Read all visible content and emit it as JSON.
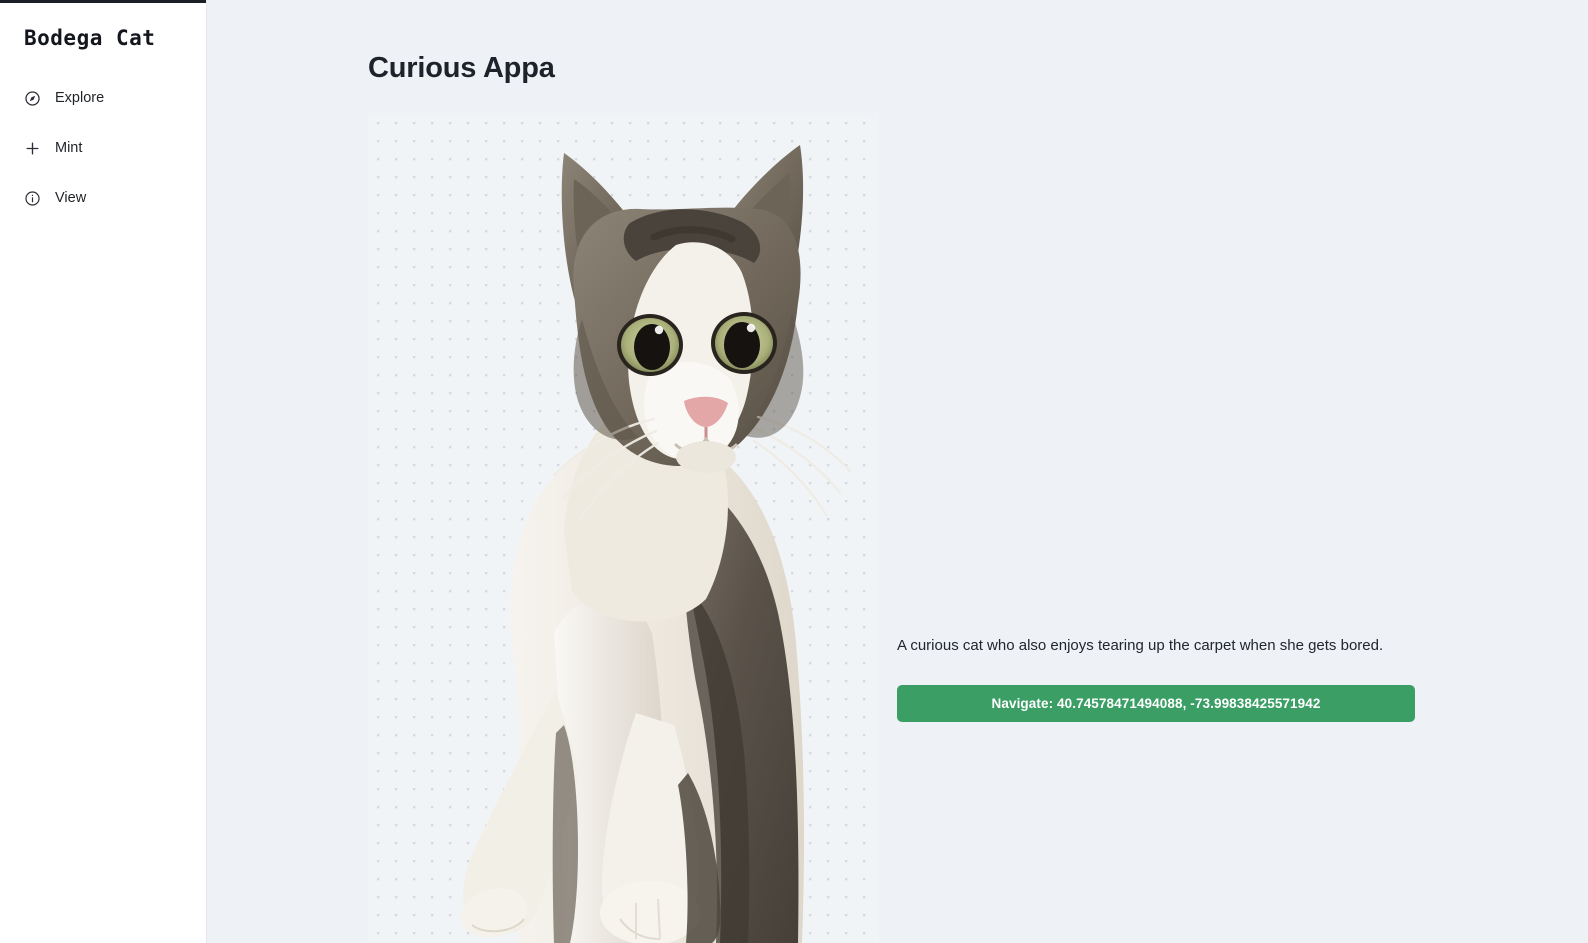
{
  "sidebar": {
    "brand": "Bodega Cat",
    "items": [
      {
        "label": "Explore",
        "icon": "compass-icon"
      },
      {
        "label": "Mint",
        "icon": "plus-icon"
      },
      {
        "label": "View",
        "icon": "info-circle-icon"
      }
    ]
  },
  "main": {
    "title": "Curious Appa",
    "artwork": {
      "alt": "standing-tabby-and-white-cat",
      "background": "dotted-grid"
    },
    "description": "A curious cat who also enjoys tearing up the carpet when she gets bored.",
    "navigate_button": {
      "label": "Navigate: 40.74578471494088, -73.99838425571942",
      "latitude": "40.74578471494088",
      "longitude": "-73.99838425571942"
    }
  },
  "colors": {
    "page_background": "#eef1f5",
    "sidebar_background": "#ffffff",
    "accent_green": "#3a9e65",
    "title_text": "#1d222b",
    "dot_grid": "#d4d9e0"
  }
}
